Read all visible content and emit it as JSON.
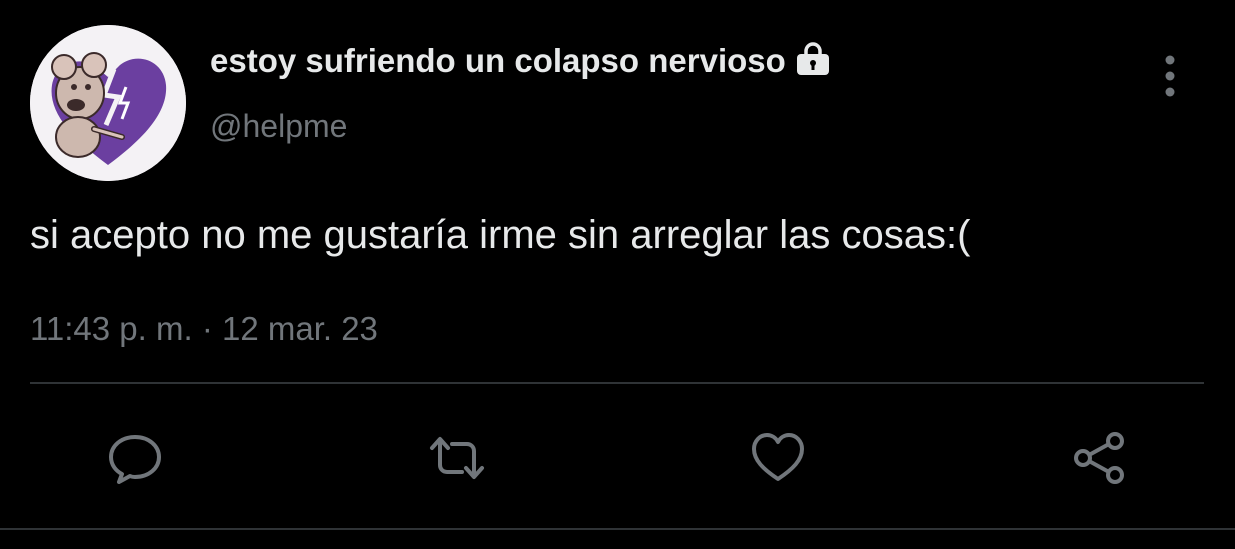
{
  "tweet": {
    "display_name": "estoy sufriendo un colapso nervioso",
    "handle": "@helpme",
    "text": "si acepto no me gustaría irme sin arreglar las cosas:(",
    "timestamp": "11:43 p. m. · 12 mar. 23",
    "protected_icon": "lock-icon"
  },
  "actions": [
    {
      "name": "reply",
      "icon": "reply-icon"
    },
    {
      "name": "retweet",
      "icon": "retweet-icon"
    },
    {
      "name": "like",
      "icon": "heart-icon"
    },
    {
      "name": "share",
      "icon": "share-icon"
    }
  ],
  "colors": {
    "background": "#000000",
    "primary_text": "#e7e9ea",
    "secondary_text": "#71767b",
    "divider": "#2f3336",
    "avatar_accent": "#6b3fa0"
  }
}
